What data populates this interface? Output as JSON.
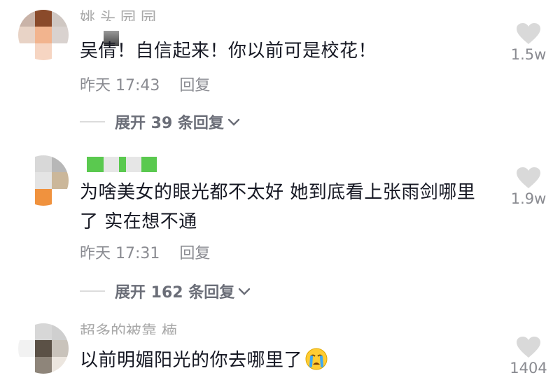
{
  "comments": [
    {
      "username": "姚 头 园 园",
      "text": "吴倩！自信起来！你以前可是校花！",
      "time": "昨天 17:43",
      "reply_label": "回复",
      "expand_label": "展开 39 条回复",
      "likes": "1.5w"
    },
    {
      "username": "",
      "text": "为啥美女的眼光都不太好 她到底看上张雨剑哪里了 实在想不通",
      "time": "昨天 17:31",
      "reply_label": "回复",
      "expand_label": "展开 162 条回复",
      "likes": "1.9w"
    },
    {
      "username": "超多的被靠 楠",
      "text": "以前明媚阳光的你去哪里了",
      "likes": "1404"
    }
  ],
  "icons": {
    "like": "heart-icon",
    "expand": "chevron-down-icon",
    "emoji": "crying-face-emoji"
  },
  "colors": {
    "text": "#161823",
    "meta": "#8a8b91",
    "heart": "#d9d9d9",
    "username_highlight": "#5ac94f"
  }
}
